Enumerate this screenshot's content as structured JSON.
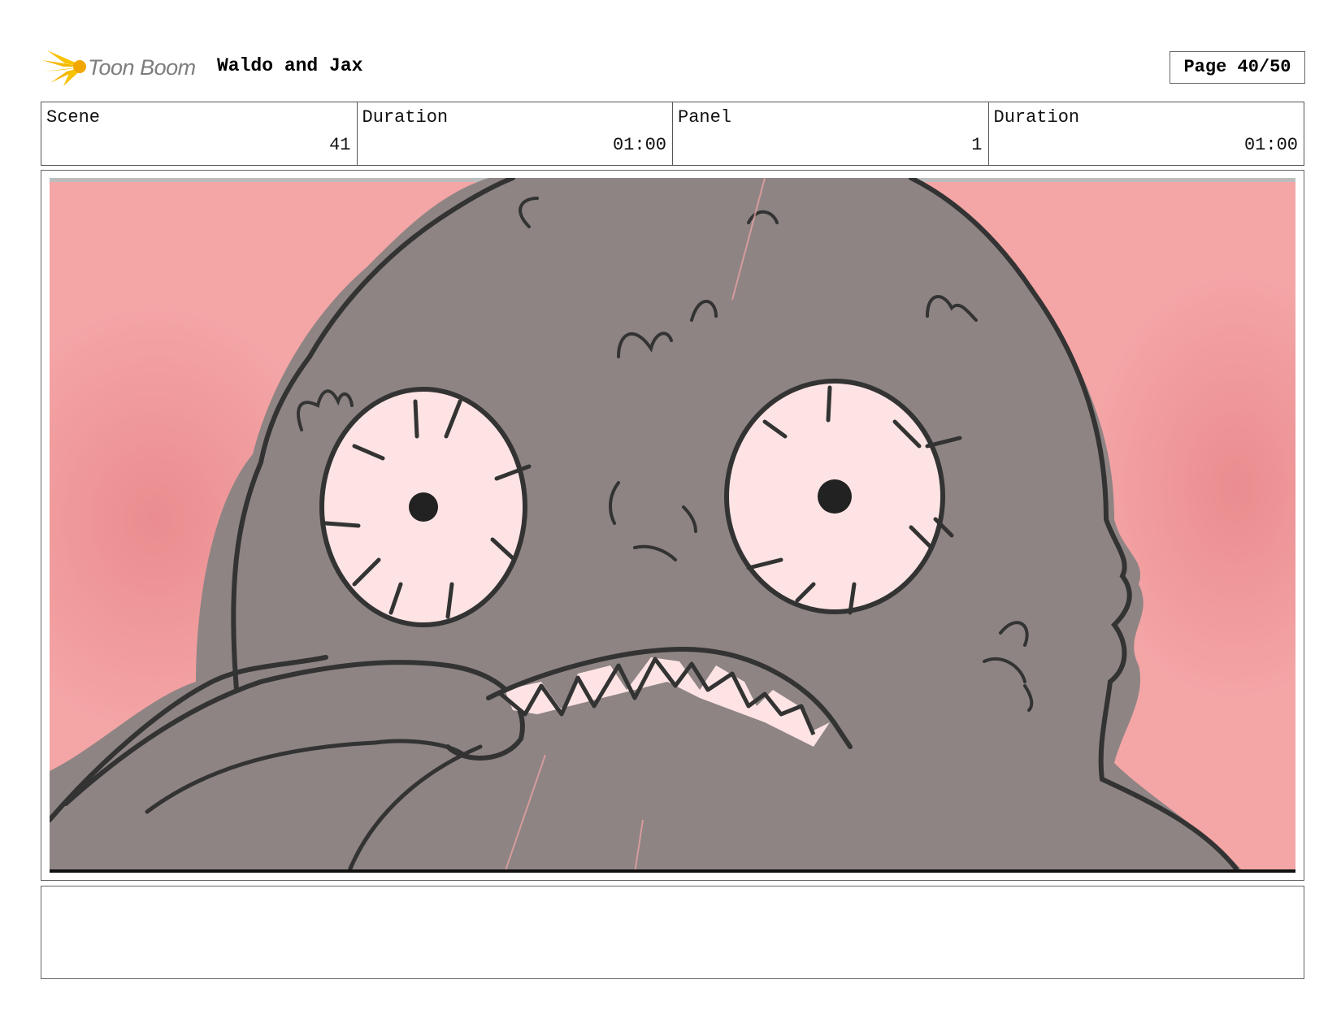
{
  "header": {
    "logo_text": "Toon Boom",
    "project_title": "Waldo and Jax",
    "page_label": "Page 40/50"
  },
  "info": [
    {
      "label": "Scene",
      "value": "41"
    },
    {
      "label": "Duration",
      "value": "01:00"
    },
    {
      "label": "Panel",
      "value": "1"
    },
    {
      "label": "Duration",
      "value": "01:00"
    }
  ],
  "panel": {
    "description": "",
    "colors": {
      "background": "#f4a5a6",
      "creature": "#8e8484",
      "eye": "#fde3e4",
      "outline": "#333333"
    }
  },
  "notes": {
    "text": ""
  }
}
